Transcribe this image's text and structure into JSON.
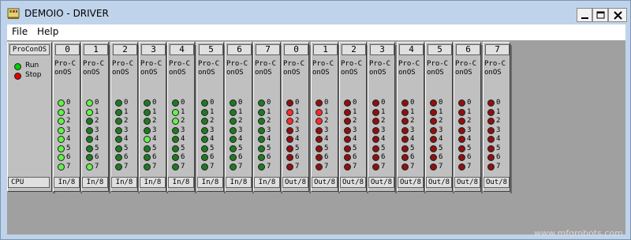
{
  "window": {
    "title": "DEMOIO - DRIVER"
  },
  "menu": {
    "file_label": "File",
    "help_label": "Help"
  },
  "cpu": {
    "header": "ProConOS",
    "run_label": "Run",
    "stop_label": "Stop",
    "footer": "CPU",
    "colors": {
      "run": "#00d000",
      "stop": "#d00000"
    }
  },
  "modules": [
    {
      "slot": "0",
      "name": "Pro-ConOS",
      "type": "In/8",
      "kind": "in",
      "states": [
        1,
        1,
        1,
        1,
        1,
        1,
        1,
        1
      ]
    },
    {
      "slot": "1",
      "name": "Pro-ConOS",
      "type": "In/8",
      "kind": "in",
      "states": [
        1,
        1,
        0,
        0,
        0,
        0,
        0,
        1
      ]
    },
    {
      "slot": "2",
      "name": "Pro-ConOS",
      "type": "In/8",
      "kind": "in",
      "states": [
        0,
        0,
        0,
        0,
        0,
        0,
        0,
        0
      ]
    },
    {
      "slot": "3",
      "name": "Pro-ConOS",
      "type": "In/8",
      "kind": "in",
      "states": [
        0,
        0,
        0,
        0,
        1,
        0,
        0,
        0
      ]
    },
    {
      "slot": "4",
      "name": "Pro-ConOS",
      "type": "In/8",
      "kind": "in",
      "states": [
        0,
        1,
        1,
        0,
        0,
        0,
        0,
        0
      ]
    },
    {
      "slot": "5",
      "name": "Pro-ConOS",
      "type": "In/8",
      "kind": "in",
      "states": [
        0,
        0,
        0,
        0,
        0,
        0,
        0,
        0
      ]
    },
    {
      "slot": "6",
      "name": "Pro-ConOS",
      "type": "In/8",
      "kind": "in",
      "states": [
        0,
        0,
        0,
        0,
        0,
        0,
        0,
        0
      ]
    },
    {
      "slot": "7",
      "name": "Pro-ConOS",
      "type": "In/8",
      "kind": "in",
      "states": [
        0,
        0,
        0,
        0,
        0,
        0,
        0,
        0
      ]
    },
    {
      "slot": "0",
      "name": "Pro-ConOS",
      "type": "Out/8",
      "kind": "out",
      "states": [
        0,
        1,
        1,
        0,
        0,
        0,
        0,
        0
      ]
    },
    {
      "slot": "1",
      "name": "Pro-ConOS",
      "type": "Out/8",
      "kind": "out",
      "states": [
        0,
        1,
        1,
        0,
        0,
        0,
        0,
        0
      ]
    },
    {
      "slot": "2",
      "name": "Pro-ConOS",
      "type": "Out/8",
      "kind": "out",
      "states": [
        0,
        0,
        0,
        0,
        0,
        0,
        0,
        0
      ]
    },
    {
      "slot": "3",
      "name": "Pro-ConOS",
      "type": "Out/8",
      "kind": "out",
      "states": [
        0,
        0,
        0,
        0,
        0,
        0,
        0,
        0
      ]
    },
    {
      "slot": "4",
      "name": "Pro-ConOS",
      "type": "Out/8",
      "kind": "out",
      "states": [
        0,
        0,
        0,
        0,
        0,
        0,
        0,
        0
      ]
    },
    {
      "slot": "5",
      "name": "Pro-ConOS",
      "type": "Out/8",
      "kind": "out",
      "states": [
        0,
        0,
        0,
        0,
        0,
        0,
        0,
        0
      ]
    },
    {
      "slot": "6",
      "name": "Pro-ConOS",
      "type": "Out/8",
      "kind": "out",
      "states": [
        0,
        0,
        0,
        0,
        0,
        0,
        0,
        0
      ]
    },
    {
      "slot": "7",
      "name": "Pro-ConOS",
      "type": "Out/8",
      "kind": "out",
      "states": [
        0,
        0,
        0,
        0,
        0,
        0,
        0,
        0
      ]
    }
  ],
  "led_colors": {
    "in_on": "#66f04a",
    "in_off": "#1f7a1f",
    "out_on": "#ff2a2a",
    "out_off": "#8e1010"
  },
  "watermark": "www.mfgrobots.com",
  "icons": {
    "app": "app-icon",
    "minimize": "minimize-icon",
    "maximize": "maximize-icon",
    "close": "close-icon"
  }
}
